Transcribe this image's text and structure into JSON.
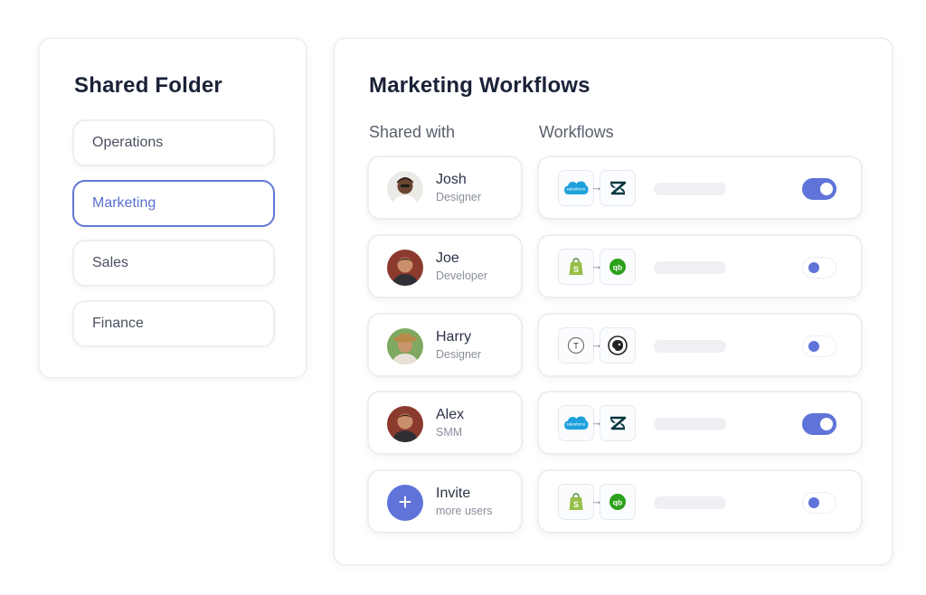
{
  "folder_panel": {
    "title": "Shared Folder",
    "items": [
      {
        "label": "Operations",
        "active": false
      },
      {
        "label": "Marketing",
        "active": true
      },
      {
        "label": "Sales",
        "active": false
      },
      {
        "label": "Finance",
        "active": false
      }
    ]
  },
  "workflow_panel": {
    "title": "Marketing Workflows",
    "shared_with_header": "Shared with",
    "workflows_header": "Workflows",
    "users": [
      {
        "name": "Josh",
        "role": "Designer"
      },
      {
        "name": "Joe",
        "role": "Developer"
      },
      {
        "name": "Harry",
        "role": "Designer"
      },
      {
        "name": "Alex",
        "role": "SMM"
      }
    ],
    "invite": {
      "name": "Invite",
      "role": "more users",
      "icon": "plus-icon"
    },
    "workflows": [
      {
        "from": "salesforce-icon",
        "to": "zendesk-icon",
        "enabled": true
      },
      {
        "from": "shopify-icon",
        "to": "quickbooks-icon",
        "enabled": false
      },
      {
        "from": "typeform-icon",
        "to": "mailchimp-icon",
        "enabled": false
      },
      {
        "from": "salesforce-icon",
        "to": "zendesk-icon",
        "enabled": true
      },
      {
        "from": "shopify-icon",
        "to": "quickbooks-icon",
        "enabled": false
      }
    ],
    "arrow": "→",
    "app_labels": {
      "salesforce": "salesforce",
      "typeform": "T",
      "quickbooks": "qb"
    }
  },
  "colors": {
    "accent": "#5f73d8",
    "salesforce": "#1ea0dc",
    "shopify": "#95bf47",
    "quickbooks": "#2ca01c",
    "zendesk": "#03363d"
  }
}
